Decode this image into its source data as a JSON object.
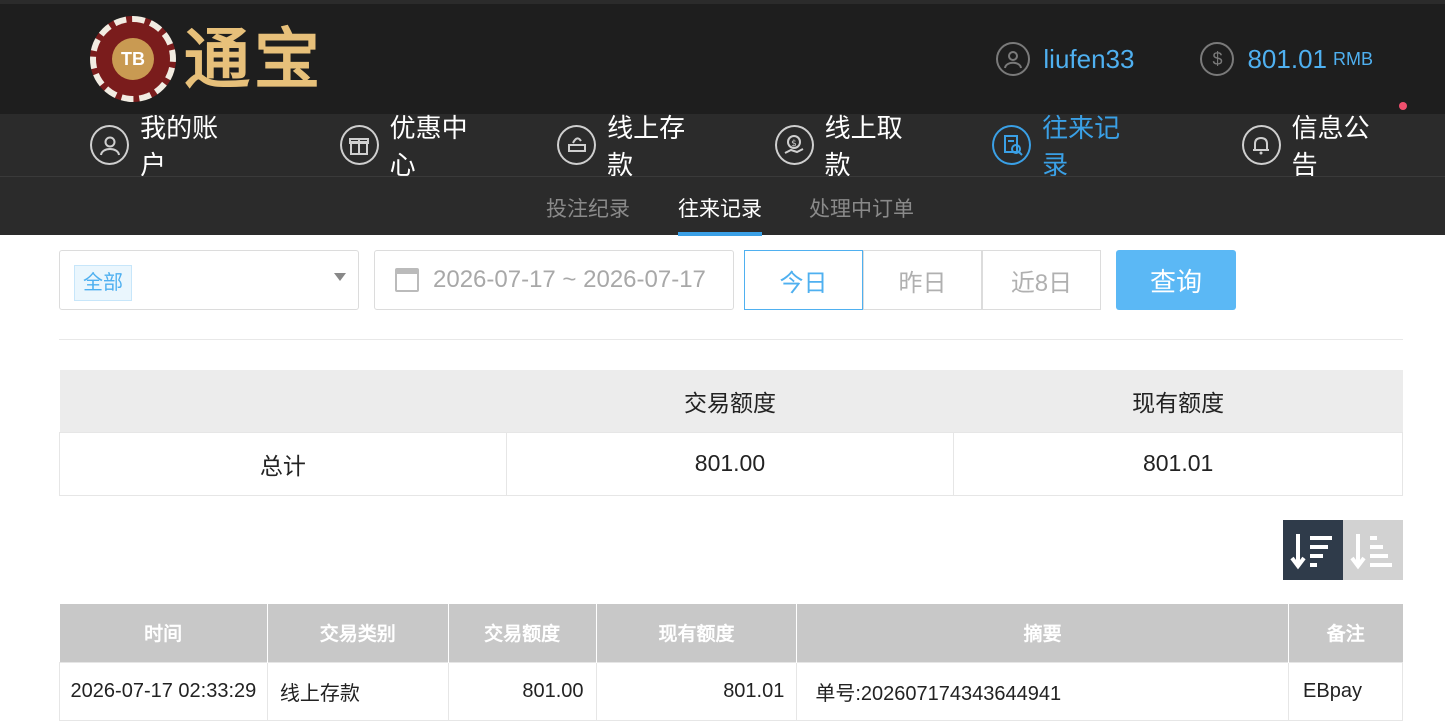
{
  "header": {
    "logo_badge": "TB",
    "logo_text": "通宝",
    "username": "liufen33",
    "balance": "801.01",
    "currency": "RMB",
    "user_icon": "user-icon",
    "balance_icon": "dollar-icon"
  },
  "nav": {
    "items": [
      {
        "label": "我的账户",
        "icon": "user-icon"
      },
      {
        "label": "优惠中心",
        "icon": "gift-icon"
      },
      {
        "label": "线上存款",
        "icon": "deposit-icon"
      },
      {
        "label": "线上取款",
        "icon": "withdraw-icon"
      },
      {
        "label": "往来记录",
        "icon": "record-icon"
      },
      {
        "label": "信息公告",
        "icon": "bell-icon"
      }
    ],
    "active": "往来记录"
  },
  "subnav": {
    "tabs": [
      "投注纪录",
      "往来记录",
      "处理中订单"
    ],
    "active": "往来记录"
  },
  "filters": {
    "type_selected": "全部",
    "date_range": "2026-07-17 ~ 2026-07-17",
    "range_buttons": [
      "今日",
      "昨日",
      "近8日"
    ],
    "range_active": "今日",
    "query_label": "查询"
  },
  "summary": {
    "headers": [
      "",
      "交易额度",
      "现有额度"
    ],
    "row_label": "总计",
    "trade_amount": "801.00",
    "current_amount": "801.01"
  },
  "records": {
    "headers": [
      "时间",
      "交易类别",
      "交易额度",
      "现有额度",
      "摘要",
      "备注"
    ],
    "rows": [
      {
        "time": "2026-07-17 02:33:29",
        "type": "线上存款",
        "amount": "801.00",
        "balance": "801.01",
        "summary": "单号:202607174343644941",
        "remark": "EBpay"
      }
    ]
  },
  "colors": {
    "accent": "#3aa0e6",
    "header_bg": "#1e1e1e",
    "nav_bg": "#2b2b2b",
    "query_bg": "#5bb8f5"
  }
}
